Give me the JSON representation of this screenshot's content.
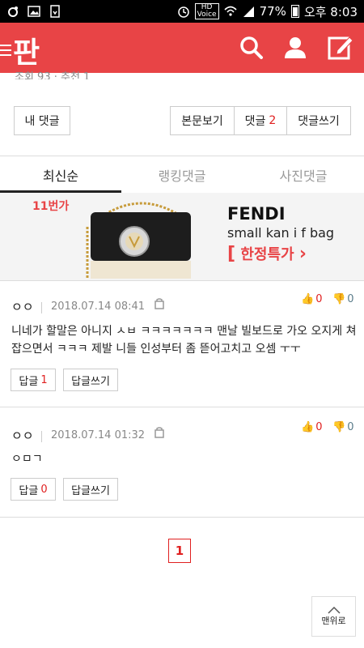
{
  "status_bar": {
    "battery": "77%",
    "time": "오후 8:03",
    "hd_label": "HD",
    "voice_label": "Voice"
  },
  "app": {
    "logo": "판",
    "accent_color": "#e84446",
    "icons": [
      "menu-icon",
      "search-icon",
      "user-icon",
      "write-icon"
    ]
  },
  "residue_text": "조회 93 · 추천 1",
  "actions": {
    "my_comments": "내 댓글",
    "view_post": "본문보기",
    "comments_label": "댓글",
    "comments_count": "2",
    "write_comment": "댓글쓰기"
  },
  "tabs": [
    {
      "label": "최신순",
      "active": true
    },
    {
      "label": "랭킹댓글",
      "active": false
    },
    {
      "label": "사진댓글",
      "active": false
    }
  ],
  "ad": {
    "badge": "11번가",
    "brand": "FENDI",
    "product": "small kan i f bag",
    "deal": "한정특가"
  },
  "comments": [
    {
      "author": "ㅇㅇ",
      "date": "2018.07.14 08:41",
      "upvotes": "0",
      "downvotes": "0",
      "text": "니네가 할말은 아니지 ㅅㅂ ㅋㅋㅋㅋㅋㅋㅋ 맨날 빌보드로 가오 오지게 쳐잡으면서 ㅋㅋㅋ 제발 니들 인성부터 좀 뜯어고치고 오셈 ㅜㅜ",
      "reply_label": "답글",
      "reply_count": "1",
      "write_reply": "답글쓰기"
    },
    {
      "author": "ㅇㅇ",
      "date": "2018.07.14 01:32",
      "upvotes": "0",
      "downvotes": "0",
      "text": "ㅇㅁㄱ",
      "reply_label": "답글",
      "reply_count": "0",
      "write_reply": "답글쓰기"
    }
  ],
  "pagination": {
    "current": "1"
  },
  "top_button": "맨위로"
}
